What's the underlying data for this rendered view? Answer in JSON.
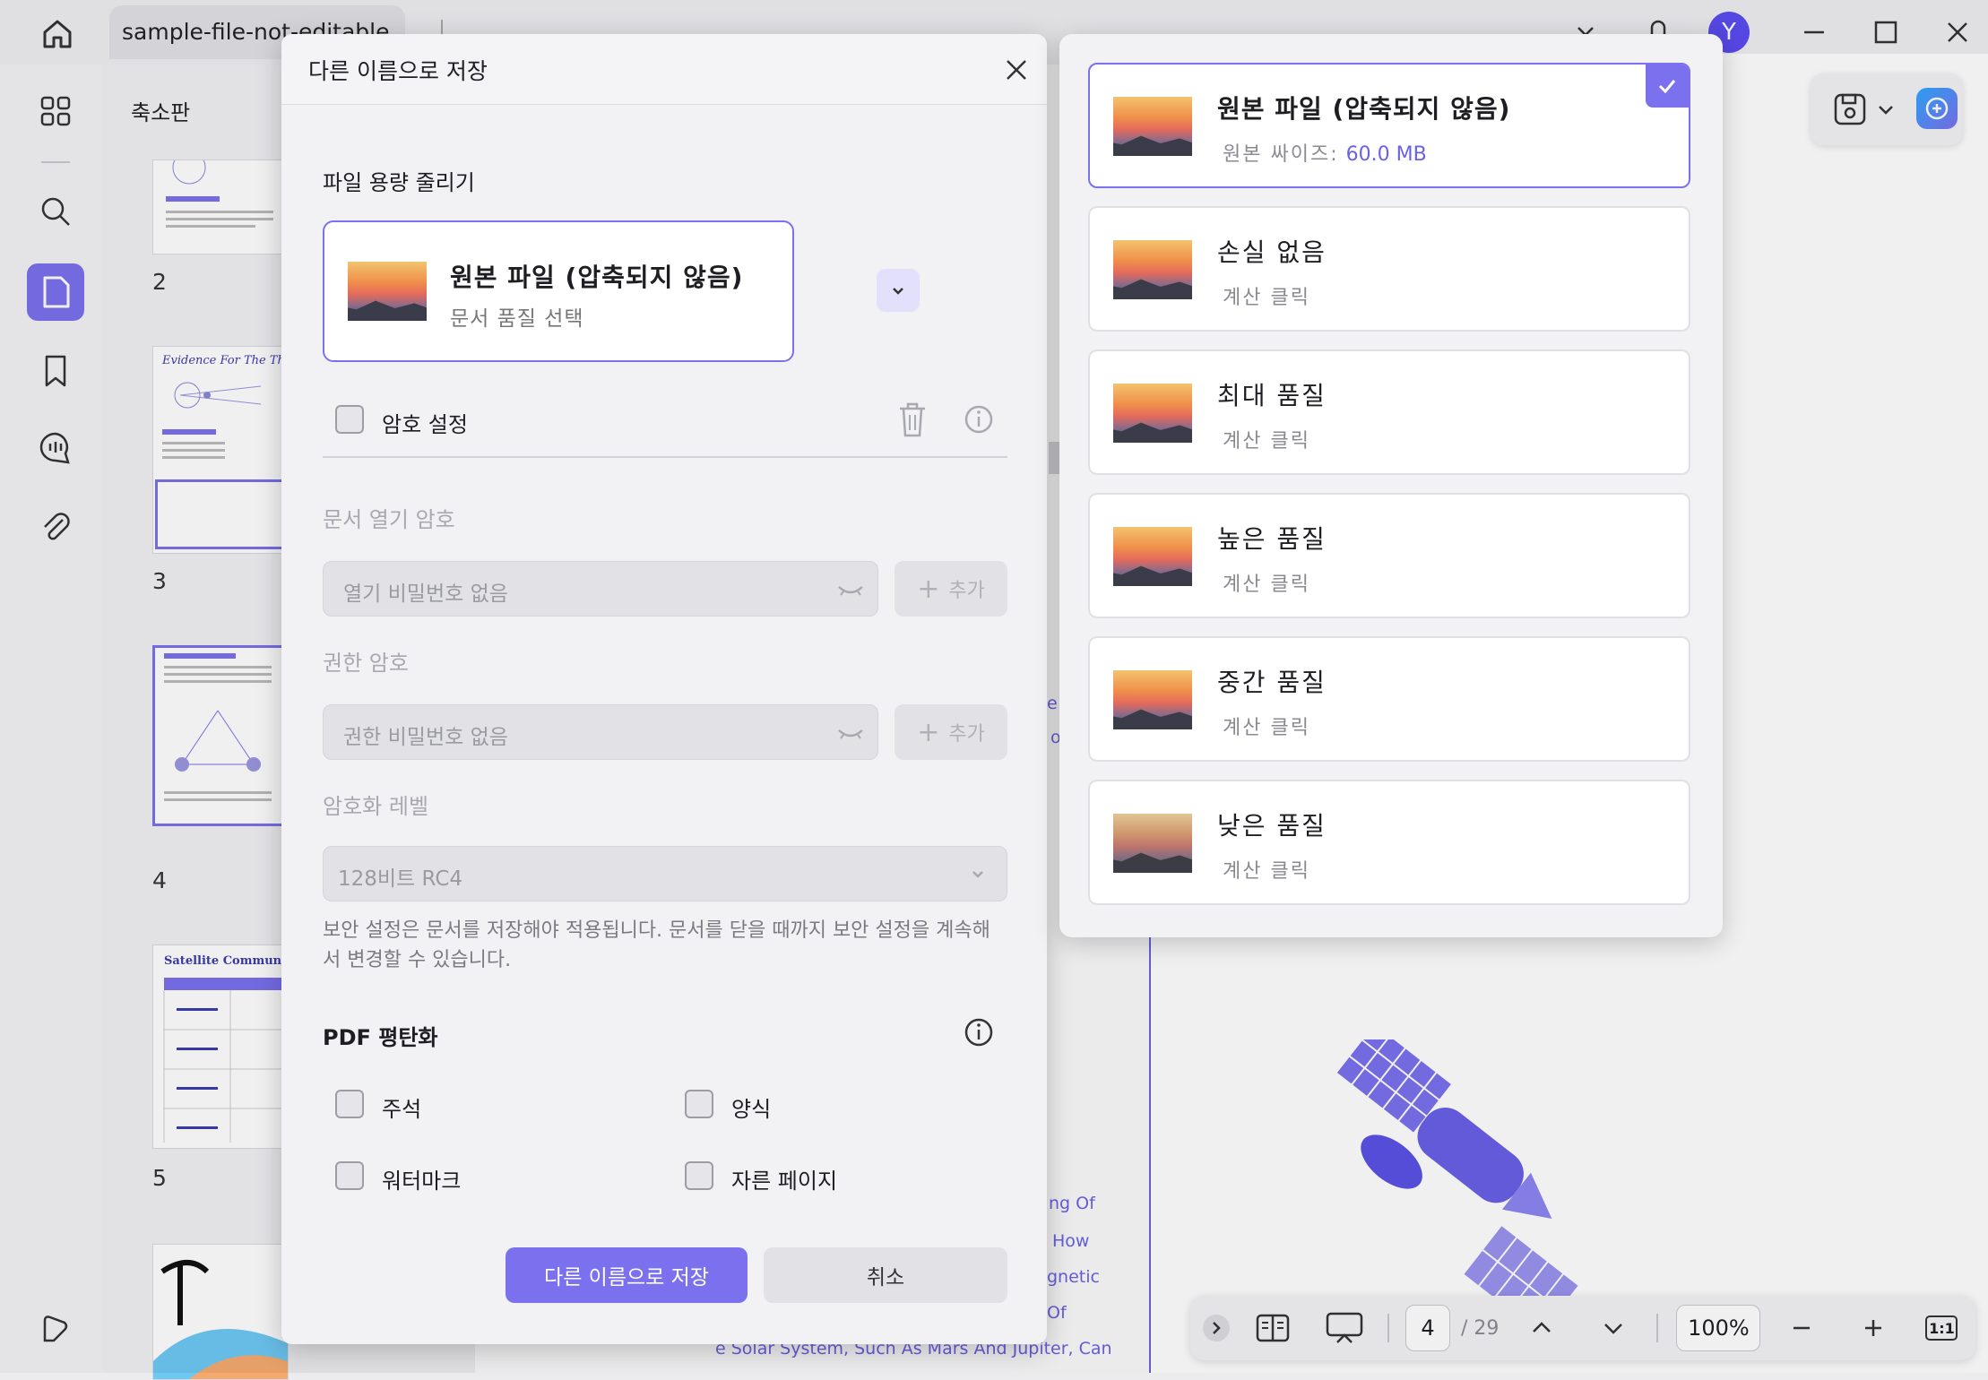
{
  "app": {
    "file_tab": "sample-file-not-editable",
    "avatar_initial": "Y",
    "accent_color": "#7b71ef"
  },
  "thumbnail_panel": {
    "title": "축소판",
    "pages": [
      "2",
      "3",
      "4",
      "5"
    ],
    "thumb_texts": {
      "p3_title": "Evidence For The Theori",
      "p5_title": "Satellite Communication"
    }
  },
  "document": {
    "lines": [
      "ng Of",
      "How",
      "gnetic",
      "Of",
      "e Solar System, Such As Mars And Jupiter, Can"
    ]
  },
  "bottom_bar": {
    "current_page": "4",
    "total_pages": "/ 29",
    "zoom": "100%",
    "fit_label": "1:1"
  },
  "dialog": {
    "title": "다른 이름으로 저장",
    "reduce_section_title": "파일 용량 줄리기",
    "selected_quality": {
      "name": "원본 파일 (압축되지 않음)",
      "subtitle": "문서 품질 선택"
    },
    "password_checkbox_label": "암호 설정",
    "open_password": {
      "label": "문서 열기 암호",
      "placeholder": "열기 비밀번호 없음",
      "add_label": "추가"
    },
    "permission_password": {
      "label": "권한 암호",
      "placeholder": "권한 비밀번호 없음",
      "add_label": "추가"
    },
    "encryption": {
      "label": "암호화 레벨",
      "value": "128비트 RC4"
    },
    "security_note": "보안 설정은 문서를 저장해야 적용됩니다. 문서를 닫을 때까지 보안 설정을 계속해서 변경할 수 있습니다.",
    "flatten": {
      "title": "PDF 평탄화",
      "options": [
        "주석",
        "양식",
        "워터마크",
        "자른 페이지"
      ]
    },
    "save_button": "다른 이름으로 저장",
    "cancel_button": "취소"
  },
  "quality_dropdown": {
    "options": [
      {
        "name": "원본 파일 (압축되지 않음)",
        "sub_label": "원본 싸이즈:",
        "sub_value": "60.0 MB",
        "selected": true
      },
      {
        "name": "손실 없음",
        "sub_label": "계산 클릭",
        "selected": false
      },
      {
        "name": "최대 품질",
        "sub_label": "계산 클릭",
        "selected": false
      },
      {
        "name": "높은 품질",
        "sub_label": "계산 클릭",
        "selected": false
      },
      {
        "name": "중간 품질",
        "sub_label": "계산 클릭",
        "selected": false
      },
      {
        "name": "낮은 품질",
        "sub_label": "계산 클릭",
        "selected": false
      }
    ]
  }
}
